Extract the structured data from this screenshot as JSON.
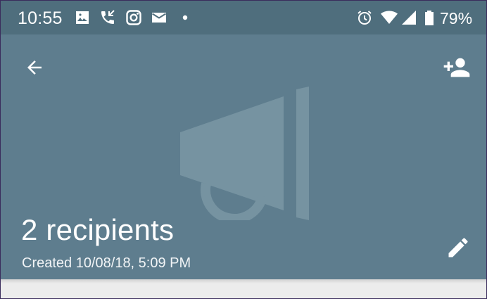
{
  "status_bar": {
    "time": "10:55",
    "battery_percent": "79%",
    "icons": [
      "image-icon",
      "missed-call-icon",
      "instagram-icon",
      "mail-icon",
      "dot-icon",
      "alarm-icon",
      "wifi-icon",
      "signal-icon",
      "battery-icon"
    ],
    "background_color": "#4f6e7d"
  },
  "header": {
    "background_color": "#5e7d8e",
    "back_icon": "arrow-back-icon",
    "add_recipient_icon": "add-person-icon",
    "hero_icon": "megaphone-icon",
    "title": "2 recipients",
    "subtitle": "Created 10/08/18, 5:09 PM",
    "edit_icon": "pencil-icon"
  }
}
